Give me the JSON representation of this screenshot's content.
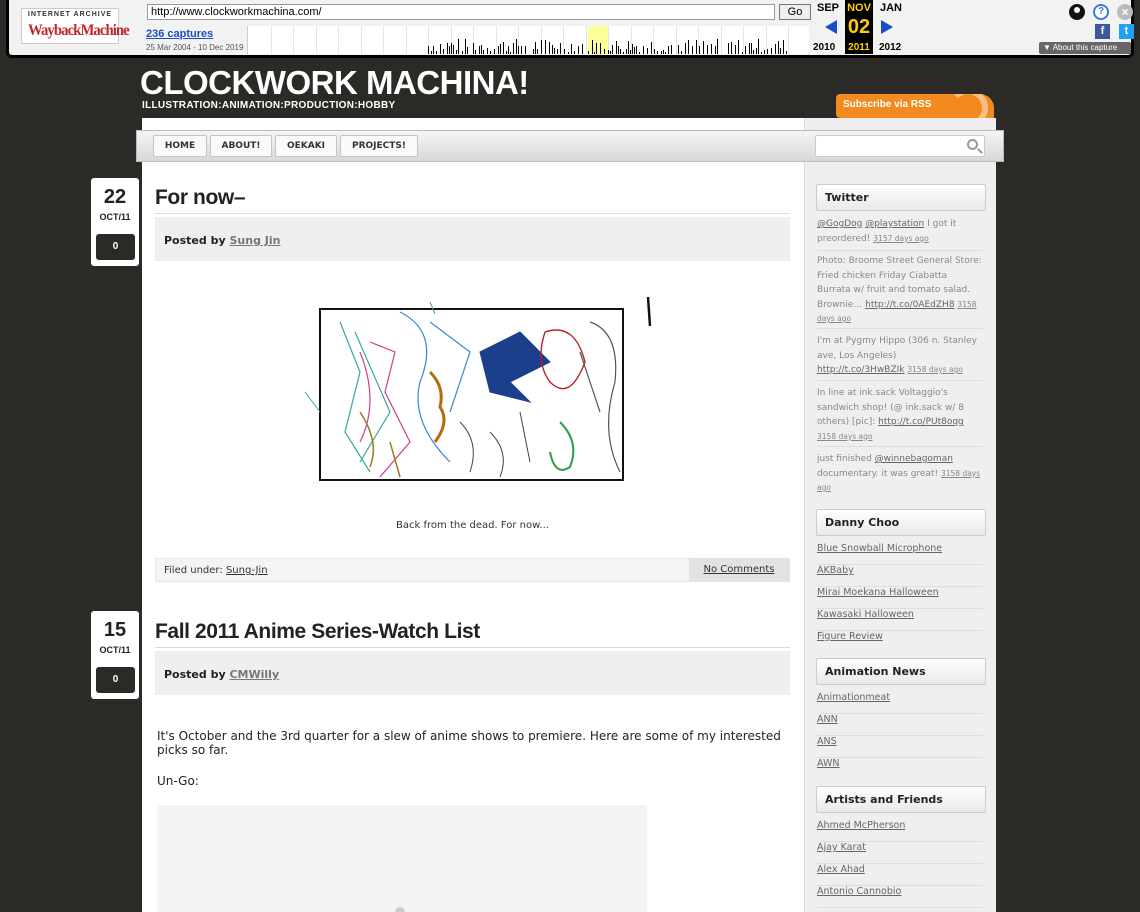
{
  "wayback": {
    "logo_top": "INTERNET ARCHIVE",
    "logo_main": "WaybackMachine",
    "url": "http://www.clockworkmachina.com/",
    "go_label": "Go",
    "captures": "236 captures",
    "range": "25 Mar 2004 - 10 Dec 2019",
    "prev_month": "SEP",
    "cur_month": "NOV",
    "next_month": "JAN",
    "cur_day": "02",
    "prev_year": "2010",
    "cur_year": "2011",
    "next_year": "2012",
    "help": "?",
    "close": "×",
    "fb": "f",
    "tw": "t",
    "about": "▼ About this capture"
  },
  "blog": {
    "title": "CLOCKWORK MACHINA!",
    "tagline": "ILLUSTRATION:ANIMATION:PRODUCTION:HOBBY",
    "rss": "Subscribe via RSS"
  },
  "nav": {
    "items": [
      {
        "label": "HOME"
      },
      {
        "label": "ABOUT!"
      },
      {
        "label": "OEKAKI"
      },
      {
        "label": "PROJECTS!"
      }
    ]
  },
  "posts": [
    {
      "day": "22",
      "month": "OCT/11",
      "comments": "0",
      "title": "For now–",
      "posted_by_label": "Posted by",
      "author": "Sung Jin",
      "caption": "Back from the dead. For now...",
      "filed_label": "Filed under:",
      "category": "Sung-Jin",
      "comment_link": "No Comments"
    },
    {
      "day": "15",
      "month": "OCT/11",
      "comments": "0",
      "title": "Fall 2011 Anime Series-Watch List",
      "posted_by_label": "Posted by",
      "author": "CMWilly",
      "para1": "It's October and the 3rd quarter for a slew of anime shows to premiere. Here are some of my interested picks so far.",
      "para2": "Un-Go:"
    }
  ],
  "sidebar": {
    "twitter_title": "Twitter",
    "tweets": [
      {
        "pre": "",
        "link1": "@GogDog",
        "mid": " ",
        "link2": "@playstation",
        "text": " I got it preordered! ",
        "ago": "3157 days ago"
      },
      {
        "text": "Photo: Broome Street General Store: Fried chicken Friday Ciabatta Burrata w/ fruit and tomato salad. Brownie… ",
        "link": "http://t.co/0AEdZH8",
        "ago": "3158 days ago"
      },
      {
        "text": "I'm at Pygmy Hippo (306 n. Stanley ave, Los Angeles) ",
        "link": "http://t.co/3HwBZIk",
        "ago": "3158 days ago"
      },
      {
        "text": "In line at ink.sack Voltaggio's sandwich shop! (@ ink.sack w/ 8 others) [pic]: ",
        "link": "http://t.co/PUt8oqg",
        "ago": "3158 days ago"
      },
      {
        "text": "just finished ",
        "link": "@winnebagoman",
        "text2": " documentary. it was great! ",
        "ago": "3158 days ago"
      }
    ],
    "danny_title": "Danny Choo",
    "danny_links": [
      "Blue Snowball Microphone",
      "AKBaby",
      "Mirai Moekana Halloween",
      "Kawasaki Halloween",
      "Figure Review"
    ],
    "anim_title": "Animation News",
    "anim_links": [
      "Animationmeat",
      "ANN",
      "ANS",
      "AWN"
    ],
    "artists_title": "Artists and Friends",
    "artists_links": [
      "Ahmed McPherson",
      "Ajay Karat",
      "Alex Ahad",
      "Antonio Cannobio"
    ]
  }
}
